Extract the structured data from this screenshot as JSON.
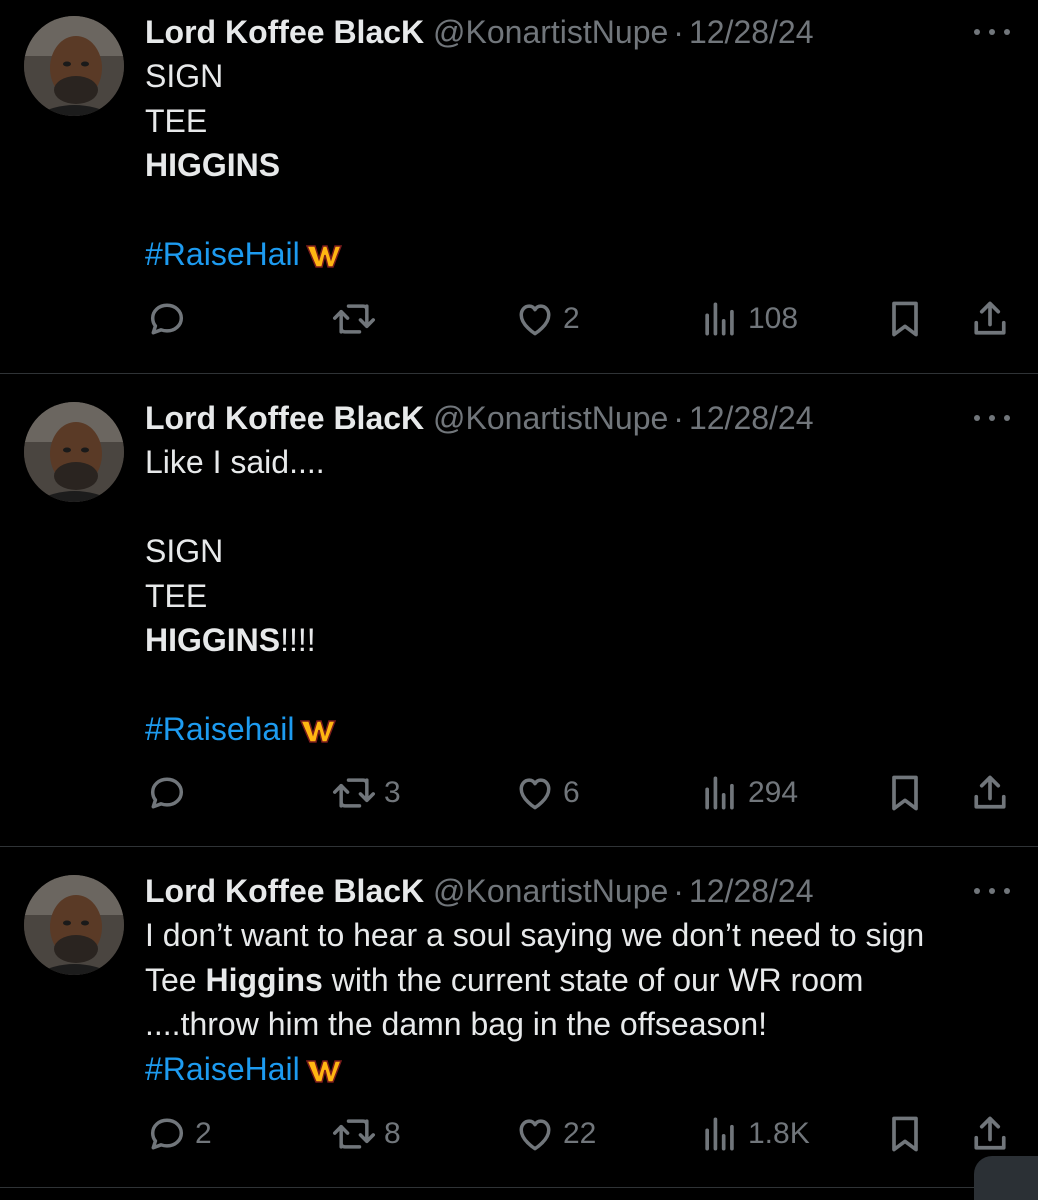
{
  "theme": {
    "background": "#000000",
    "text": "#e7e9ea",
    "muted": "#71767b",
    "link": "#1d9bf0",
    "divider": "#2f3336",
    "brand_burgundy": "#5a1414",
    "brand_gold": "#ffb612"
  },
  "tweets": [
    {
      "author": {
        "name": "Lord Koffee BlacK",
        "handle": "@KonartistNupe",
        "separator": "·",
        "date": "12/28/24"
      },
      "text": {
        "l1": "SIGN",
        "l2": "TEE",
        "l3": "HIGGINS",
        "hashtag": "#RaiseHail"
      },
      "stats": {
        "replies": "",
        "reposts": "",
        "likes": "2",
        "views": "108"
      }
    },
    {
      "author": {
        "name": "Lord Koffee BlacK",
        "handle": "@KonartistNupe",
        "separator": "·",
        "date": "12/28/24"
      },
      "text": {
        "l1": "Like I said....",
        "l2": "SIGN",
        "l3": "TEE",
        "l4_bold": "HIGGINS",
        "l4_rest": "!!!!",
        "hashtag": "#Raisehail"
      },
      "stats": {
        "replies": "",
        "reposts": "3",
        "likes": "6",
        "views": "294"
      }
    },
    {
      "author": {
        "name": "Lord Koffee BlacK",
        "handle": "@KonartistNupe",
        "separator": "·",
        "date": "12/28/24"
      },
      "text": {
        "l1": "I don’t want to hear a soul saying we don’t need to sign",
        "l2_a": "Tee ",
        "l2_bold": "Higgins",
        "l2_b": " with the current state of our WR room",
        "l3": "....throw him the damn bag in the offseason!",
        "hashtag": "#RaiseHail"
      },
      "stats": {
        "replies": "2",
        "reposts": "8",
        "likes": "22",
        "views": "1.8K"
      }
    }
  ]
}
